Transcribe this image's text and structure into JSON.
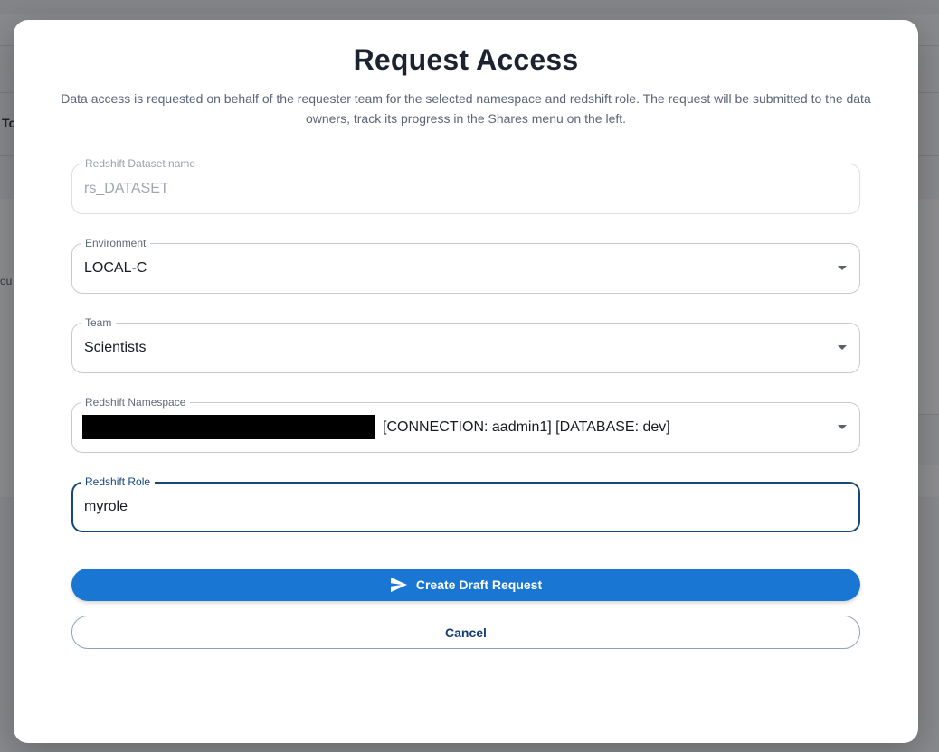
{
  "background": {
    "partial_heading": "To",
    "partial_text": "ou"
  },
  "modal": {
    "title": "Request Access",
    "subtitle": "Data access is requested on behalf of the requester team for the selected namespace and redshift role. The request will be submitted to the data owners, track its progress in the Shares menu on the left."
  },
  "fields": {
    "dataset": {
      "label": "Redshift Dataset name",
      "value": "rs_DATASET",
      "disabled": true
    },
    "environment": {
      "label": "Environment",
      "value": "LOCAL-C"
    },
    "team": {
      "label": "Team",
      "value": "Scientists"
    },
    "namespace": {
      "label": "Redshift Namespace",
      "value": "[CONNECTION: aadmin1] [DATABASE: dev]",
      "redacted_prefix": true
    },
    "role": {
      "label": "Redshift Role",
      "value": "myrole",
      "focused": true
    }
  },
  "buttons": {
    "create": {
      "label": "Create Draft Request",
      "icon": "send-icon",
      "color": "#1976d2"
    },
    "cancel": {
      "label": "Cancel"
    }
  },
  "colors": {
    "primary": "#1976d2",
    "focus": "#15477f",
    "title": "#1b2330"
  }
}
